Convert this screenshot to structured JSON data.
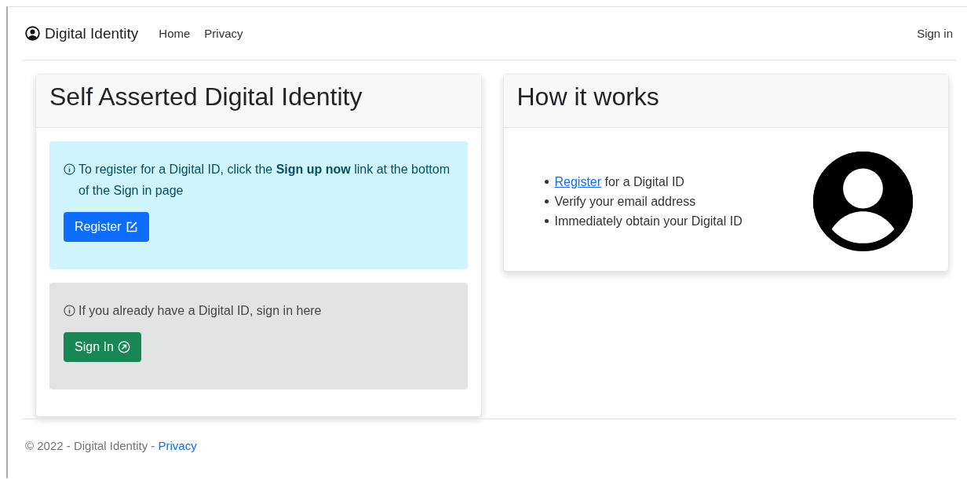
{
  "navbar": {
    "brand": "Digital Identity",
    "links": [
      {
        "label": "Home"
      },
      {
        "label": "Privacy"
      }
    ],
    "sign_in": "Sign in"
  },
  "left_card": {
    "title": "Self Asserted Digital Identity",
    "alerts": [
      {
        "kind": "info",
        "text": "To register for a Digital ID, click the **Sign up now** link at the bottom of the Sign in page",
        "button": "Register"
      },
      {
        "kind": "secondary",
        "text": "If you already have a Digital ID, sign in here",
        "button": "Sign In"
      }
    ]
  },
  "right_card": {
    "title": "How it works",
    "steps": [
      {
        "link": "Register",
        "text": " for a Digital ID"
      },
      {
        "text": "Verify your email address"
      },
      {
        "text": "Immediately obtain your Digital ID"
      }
    ]
  },
  "footer": {
    "text": "© 2022 - Digital Identity - ",
    "link": "Privacy"
  }
}
